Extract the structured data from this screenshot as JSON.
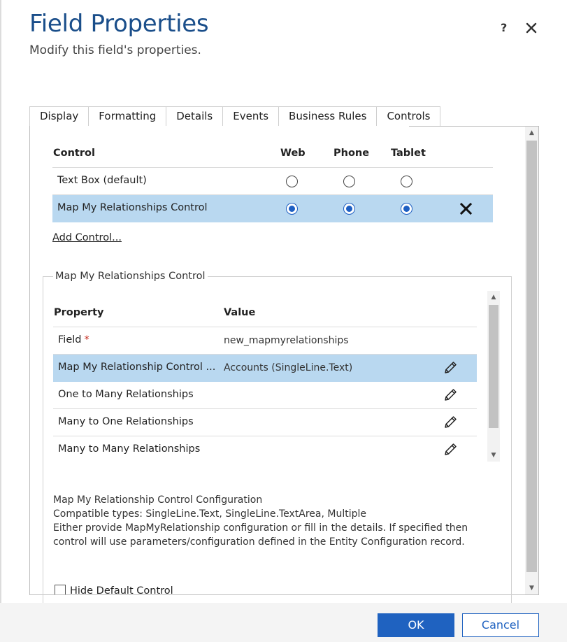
{
  "dialog": {
    "title": "Field Properties",
    "subtitle": "Modify this field's properties.",
    "help_label": "?"
  },
  "tabs": [
    {
      "label": "Display"
    },
    {
      "label": "Formatting"
    },
    {
      "label": "Details"
    },
    {
      "label": "Events"
    },
    {
      "label": "Business Rules"
    },
    {
      "label": "Controls",
      "active": true
    }
  ],
  "controls_table": {
    "headers": {
      "control": "Control",
      "web": "Web",
      "phone": "Phone",
      "tablet": "Tablet"
    },
    "rows": [
      {
        "name": "Text Box (default)",
        "web": false,
        "phone": false,
        "tablet": false,
        "selected": false
      },
      {
        "name": "Map My Relationships Control",
        "web": true,
        "phone": true,
        "tablet": true,
        "selected": true
      }
    ],
    "add_control_label": "Add Control..."
  },
  "properties_group": {
    "legend": "Map My Relationships Control",
    "headers": {
      "property": "Property",
      "value": "Value"
    },
    "rows": [
      {
        "name": "Field",
        "required_mark": "*",
        "value": "new_mapmyrelationships",
        "editable": false
      },
      {
        "name": "Map My Relationship Control ...",
        "value": "Accounts (SingleLine.Text)",
        "editable": true,
        "selected": true
      },
      {
        "name": "One to Many Relationships",
        "value": "",
        "editable": true
      },
      {
        "name": "Many to One Relationships",
        "value": "",
        "editable": true
      },
      {
        "name": "Many to Many Relationships",
        "value": "",
        "editable": true
      }
    ],
    "description": {
      "line1": "Map My Relationship Control Configuration",
      "line2": "Compatible types: SingleLine.Text, SingleLine.TextArea, Multiple",
      "line3": "Either provide MapMyRelationship configuration or fill in the details. If specified then",
      "line4": "control will use parameters/configuration defined in the Entity Configuration record."
    },
    "hide_default_label": "Hide Default Control"
  },
  "footer": {
    "ok_label": "OK",
    "cancel_label": "Cancel"
  },
  "colors": {
    "title": "#1a4e8a",
    "selection": "#b9d8f0",
    "primary_button": "#1f62c0",
    "radio_selected": "#1e5fc2",
    "required": "#c4281c"
  }
}
